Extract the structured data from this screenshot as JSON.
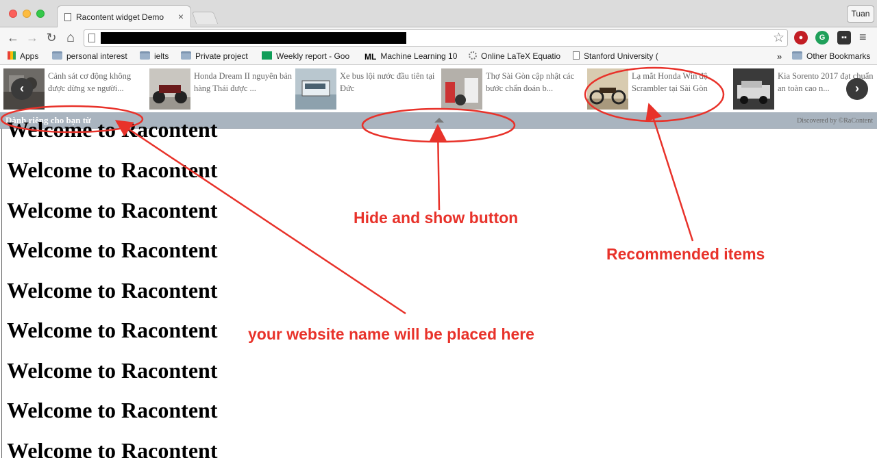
{
  "browser": {
    "tab_title": "Racontent widget Demo",
    "tab_close": "×",
    "profile_name": "Tuan",
    "nav": {
      "back": "←",
      "forward": "→",
      "reload": "↻",
      "home": "⌂"
    },
    "omnibox_star": "☆",
    "menu": "≡"
  },
  "bookmarks": [
    {
      "label": "Apps",
      "icon": "apps-grid-icon"
    },
    {
      "label": "personal interest",
      "icon": "folder-icon"
    },
    {
      "label": "ielts",
      "icon": "folder-icon"
    },
    {
      "label": "Private project",
      "icon": "folder-icon"
    },
    {
      "label": "Weekly report - Goo",
      "icon": "sheets-icon"
    },
    {
      "label": "Machine Learning 10",
      "icon": "ml-icon"
    },
    {
      "label": "Online LaTeX Equatio",
      "icon": "gear-icon"
    },
    {
      "label": "Stanford University (",
      "icon": "page-icon"
    }
  ],
  "bookmarks_overflow": "»",
  "bookmarks_other": "Other Bookmarks",
  "widget": {
    "items": [
      {
        "title": "Cảnh sát cơ động không được dừng xe người..."
      },
      {
        "title": "Honda Dream II nguyên bản hàng Thái được ..."
      },
      {
        "title": "Xe bus lội nước đầu tiên tại Đức"
      },
      {
        "title": "Thợ Sài Gòn cập nhật các bước chẩn đoán b..."
      },
      {
        "title": "Lạ mắt Honda Win độ Scrambler tại Sài Gòn"
      },
      {
        "title": "Kia Sorento 2017 đạt chuẩn an toàn cao n..."
      }
    ],
    "prev": "‹",
    "next": "›",
    "site_label": "Dành riêng cho bạn từ",
    "discovered": "Discovered by ©RaContent"
  },
  "page": {
    "headings": [
      "Welcome to Racontent",
      "Welcome to Racontent",
      "Welcome to Racontent",
      "Welcome to Racontent",
      "Welcome to Racontent",
      "Welcome to Racontent",
      "Welcome to Racontent",
      "Welcome to Racontent",
      "Welcome to Racontent"
    ]
  },
  "annotations": {
    "hide_show": "Hide and show button",
    "recommended": "Recommended items",
    "website_name": "your website name will be placed here"
  }
}
